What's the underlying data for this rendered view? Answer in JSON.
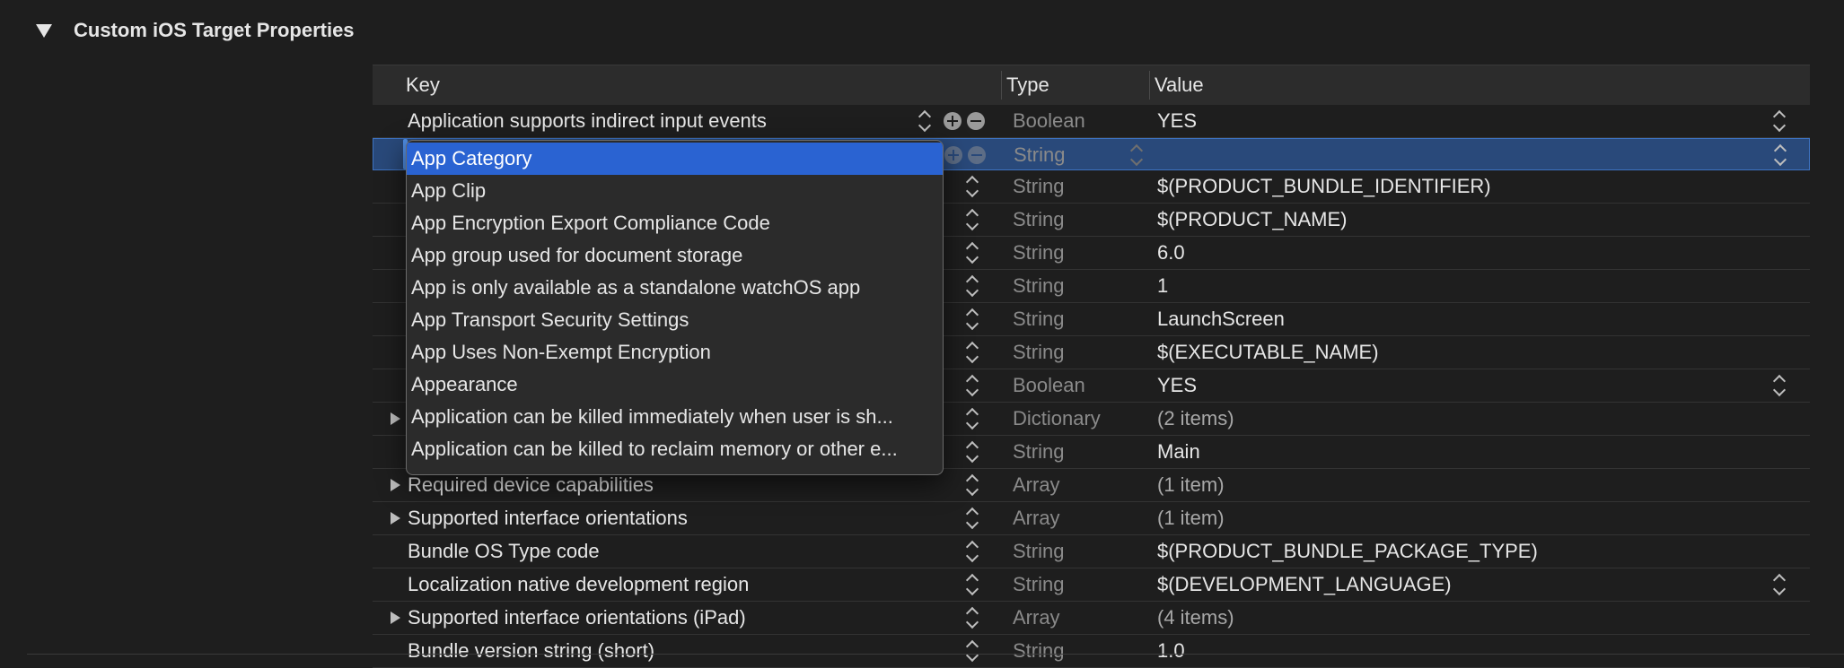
{
  "section": {
    "title": "Custom iOS Target Properties"
  },
  "table": {
    "headers": {
      "key": "Key",
      "type": "Type",
      "value": "Value"
    },
    "rows": [
      {
        "key": "Application supports indirect input events",
        "type": "Boolean",
        "value": "YES"
      },
      {
        "key": "",
        "type": "String",
        "value": ""
      },
      {
        "key": "",
        "type": "String",
        "value": "$(PRODUCT_BUNDLE_IDENTIFIER)"
      },
      {
        "key": "",
        "type": "String",
        "value": "$(PRODUCT_NAME)"
      },
      {
        "key": "",
        "type": "String",
        "value": "6.0"
      },
      {
        "key": "",
        "type": "String",
        "value": "1"
      },
      {
        "key": "",
        "type": "String",
        "value": "LaunchScreen"
      },
      {
        "key": "",
        "type": "String",
        "value": "$(EXECUTABLE_NAME)"
      },
      {
        "key": "",
        "type": "Boolean",
        "value": "YES"
      },
      {
        "key": "",
        "type": "Dictionary",
        "value": "(2 items)"
      },
      {
        "key": "",
        "type": "String",
        "value": "Main"
      },
      {
        "key": "Required device capabilities",
        "type": "Array",
        "value": "(1 item)"
      },
      {
        "key": "Supported interface orientations",
        "type": "Array",
        "value": "(1 item)"
      },
      {
        "key": "Bundle OS Type code",
        "type": "String",
        "value": "$(PRODUCT_BUNDLE_PACKAGE_TYPE)"
      },
      {
        "key": "Localization native development region",
        "type": "String",
        "value": "$(DEVELOPMENT_LANGUAGE)"
      },
      {
        "key": "Supported interface orientations (iPad)",
        "type": "Array",
        "value": "(4 items)"
      },
      {
        "key": "Bundle version string (short)",
        "type": "String",
        "value": "1.0"
      }
    ]
  },
  "popup": {
    "items": [
      "App Category",
      "App Clip",
      "App Encryption Export Compliance Code",
      "App group used for document storage",
      "App is only available as a standalone watchOS app",
      "App Transport Security Settings",
      "App Uses Non-Exempt Encryption",
      "Appearance",
      "Application can be killed immediately when user is sh...",
      "Application can be killed to reclaim memory or other e..."
    ],
    "selected": "App Category"
  },
  "colors": {
    "selection": "#29497a",
    "menu_highlight": "#2a63d2",
    "background": "#1e1e1e"
  }
}
